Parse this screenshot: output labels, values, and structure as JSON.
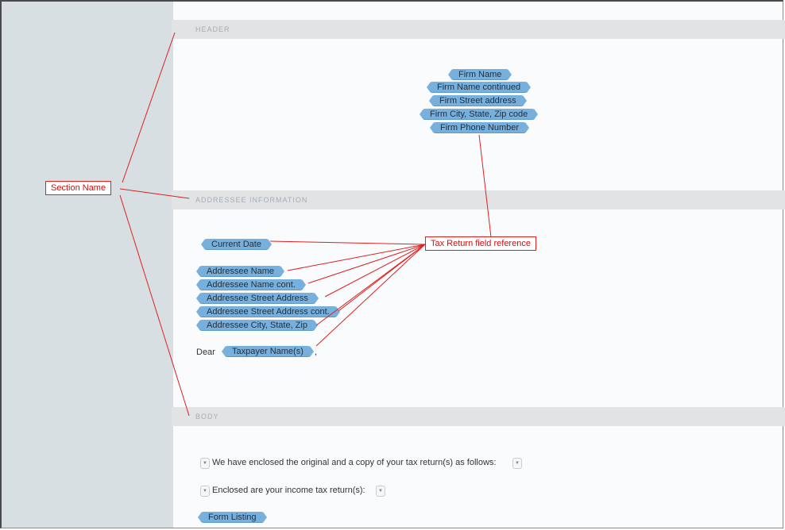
{
  "sections": {
    "header": "HEADER",
    "addressee": "ADDRESSEE INFORMATION",
    "body": "BODY"
  },
  "header_fields": [
    "Firm Name",
    "Firm Name continued",
    "Firm Street address",
    "Firm City, State, Zip code",
    "Firm Phone Number"
  ],
  "addressee": {
    "current_date": "Current Date",
    "fields": [
      "Addressee Name",
      "Addressee Name cont.",
      "Addressee Street Address",
      "Addressee Street Address cont.",
      "Addressee City, State, Zip"
    ],
    "dear": "Dear",
    "taxpayer": "Taxpayer Name(s)",
    "comma": ","
  },
  "body": {
    "line1": "We have enclosed the original and a copy of your tax return(s) as follows:",
    "line2": "Enclosed are your income tax return(s):",
    "form_listing": "Form Listing",
    "dropdown_glyph": "▼"
  },
  "annotations": {
    "section_name": "Section Name",
    "field_reference": "Tax Return field reference",
    "color": "#e02020"
  }
}
